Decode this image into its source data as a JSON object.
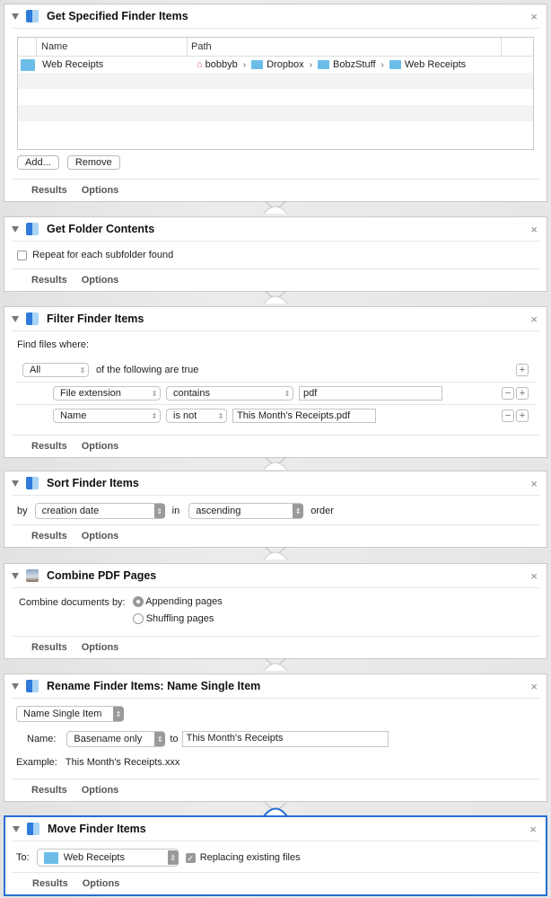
{
  "actions": [
    {
      "title": "Get Specified Finder Items",
      "table": {
        "columns": [
          "Name",
          "Path"
        ],
        "rows": [
          {
            "name": "Web Receipts",
            "path": [
              "bobbyb",
              "Dropbox",
              "BobzStuff",
              "Web Receipts"
            ]
          }
        ]
      },
      "buttons": {
        "add": "Add...",
        "remove": "Remove"
      }
    },
    {
      "title": "Get Folder Contents",
      "checkbox": {
        "label": "Repeat for each subfolder found",
        "checked": false
      }
    },
    {
      "title": "Filter Finder Items",
      "find_label": "Find files where:",
      "match": {
        "value": "All",
        "suffix": "of the following are true"
      },
      "rules": [
        {
          "field": "File extension",
          "operator": "contains",
          "value": "pdf"
        },
        {
          "field": "Name",
          "operator": "is not",
          "value": "This Month's Receipts.pdf"
        }
      ]
    },
    {
      "title": "Sort Finder Items",
      "by_label": "by",
      "by_value": "creation date",
      "in_label": "in",
      "order_value": "ascending",
      "order_label": "order"
    },
    {
      "title": "Combine PDF Pages",
      "label": "Combine documents by:",
      "options": [
        {
          "label": "Appending pages",
          "selected": true
        },
        {
          "label": "Shuffling pages",
          "selected": false
        }
      ]
    },
    {
      "title": "Rename Finder Items: Name Single Item",
      "mode": "Name Single Item",
      "name_label": "Name:",
      "name_value": "Basename only",
      "to_label": "to",
      "to_value": "This Month's Receipts",
      "example_label": "Example:",
      "example_value": "This Month's Receipts.xxx"
    },
    {
      "title": "Move Finder Items",
      "to_label": "To:",
      "to_value": "Web Receipts",
      "replace": {
        "label": "Replacing existing files",
        "checked": true
      }
    }
  ],
  "footer": {
    "results": "Results",
    "options": "Options"
  },
  "icons": {
    "close": "×",
    "chevron": "›",
    "updown": "⇕",
    "check": "✓",
    "plus": "+",
    "minus": "−"
  },
  "colors": {
    "selected_border": "#2a6dd4",
    "folder": "#6bbde8"
  }
}
